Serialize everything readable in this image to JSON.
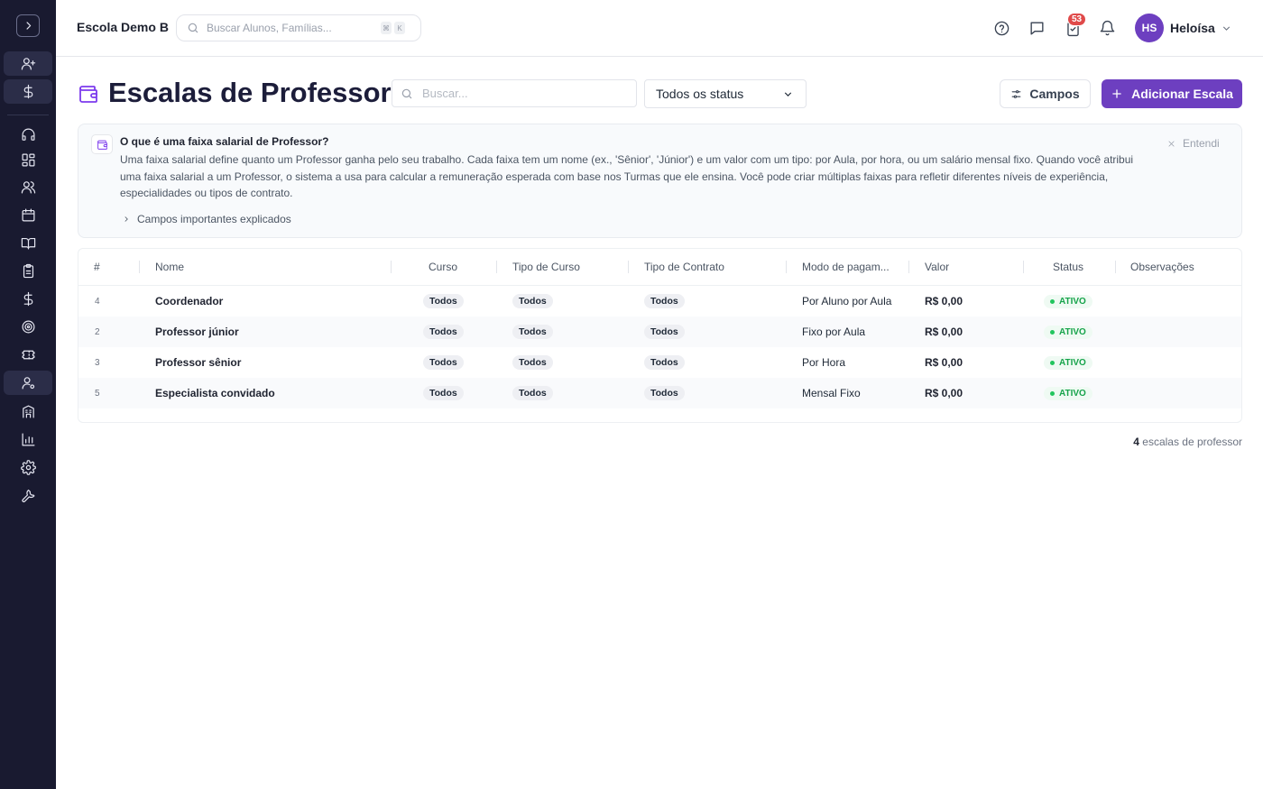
{
  "topbar": {
    "school_name": "Escola Demo B",
    "search_placeholder": "Buscar Alunos, Famílias...",
    "shortcut_keys": [
      "⌘",
      "K"
    ],
    "notification_count": "53",
    "user_initials": "HS",
    "user_name": "Heloísa"
  },
  "sidebar": {
    "icons": [
      "expand-icon",
      "user-plus-icon",
      "dollar-icon",
      "headset-icon",
      "dashboard-icon",
      "users-icon",
      "calendar-icon",
      "book-icon",
      "clipboard-icon",
      "dollar-icon",
      "target-icon",
      "ticket-icon",
      "user-settings-icon",
      "building-icon",
      "bar-chart-icon",
      "gear-icon",
      "wrench-icon"
    ]
  },
  "header": {
    "title": "Escalas de Professor",
    "search_placeholder": "Buscar...",
    "status_filter": "Todos os status",
    "fields_button": "Campos",
    "add_button": "Adicionar Escala"
  },
  "info": {
    "title": "O que é uma faixa salarial de Professor?",
    "body": "Uma faixa salarial define quanto um Professor ganha pelo seu trabalho. Cada faixa tem um nome (ex., 'Sênior', 'Júnior') e um valor com um tipo: por Aula, por hora, ou um salário mensal fixo. Quando você atribui uma faixa salarial a um Professor, o sistema a usa para calcular a remuneração esperada com base nos Turmas que ele ensina. Você pode criar múltiplas faixas para refletir diferentes níveis de experiência, especialidades ou tipos de contrato.",
    "more_link": "Campos importantes explicados",
    "dismiss": "Entendi"
  },
  "table": {
    "columns": [
      "#",
      "Nome",
      "Curso",
      "Tipo de Curso",
      "Tipo de Contrato",
      "Modo de pagam...",
      "Valor",
      "Status",
      "Observações"
    ],
    "rows": [
      {
        "id": "4",
        "name": "Coordenador",
        "course": "Todos",
        "course_type": "Todos",
        "contract_type": "Todos",
        "payment_mode": "Por Aluno por Aula",
        "value": "R$ 0,00",
        "status": "ATIVO",
        "notes": ""
      },
      {
        "id": "2",
        "name": "Professor júnior",
        "course": "Todos",
        "course_type": "Todos",
        "contract_type": "Todos",
        "payment_mode": "Fixo por Aula",
        "value": "R$ 0,00",
        "status": "ATIVO",
        "notes": ""
      },
      {
        "id": "3",
        "name": "Professor sênior",
        "course": "Todos",
        "course_type": "Todos",
        "contract_type": "Todos",
        "payment_mode": "Por Hora",
        "value": "R$ 0,00",
        "status": "ATIVO",
        "notes": ""
      },
      {
        "id": "5",
        "name": "Especialista convidado",
        "course": "Todos",
        "course_type": "Todos",
        "contract_type": "Todos",
        "payment_mode": "Mensal Fixo",
        "value": "R$ 0,00",
        "status": "ATIVO",
        "notes": ""
      }
    ]
  },
  "footer": {
    "count": "4",
    "count_label": "escalas de professor"
  },
  "colors": {
    "sidebar_bg": "#191a30",
    "accent": "#6d3fc0",
    "status_active": "#16a34a",
    "badge": "#e04a4a"
  }
}
